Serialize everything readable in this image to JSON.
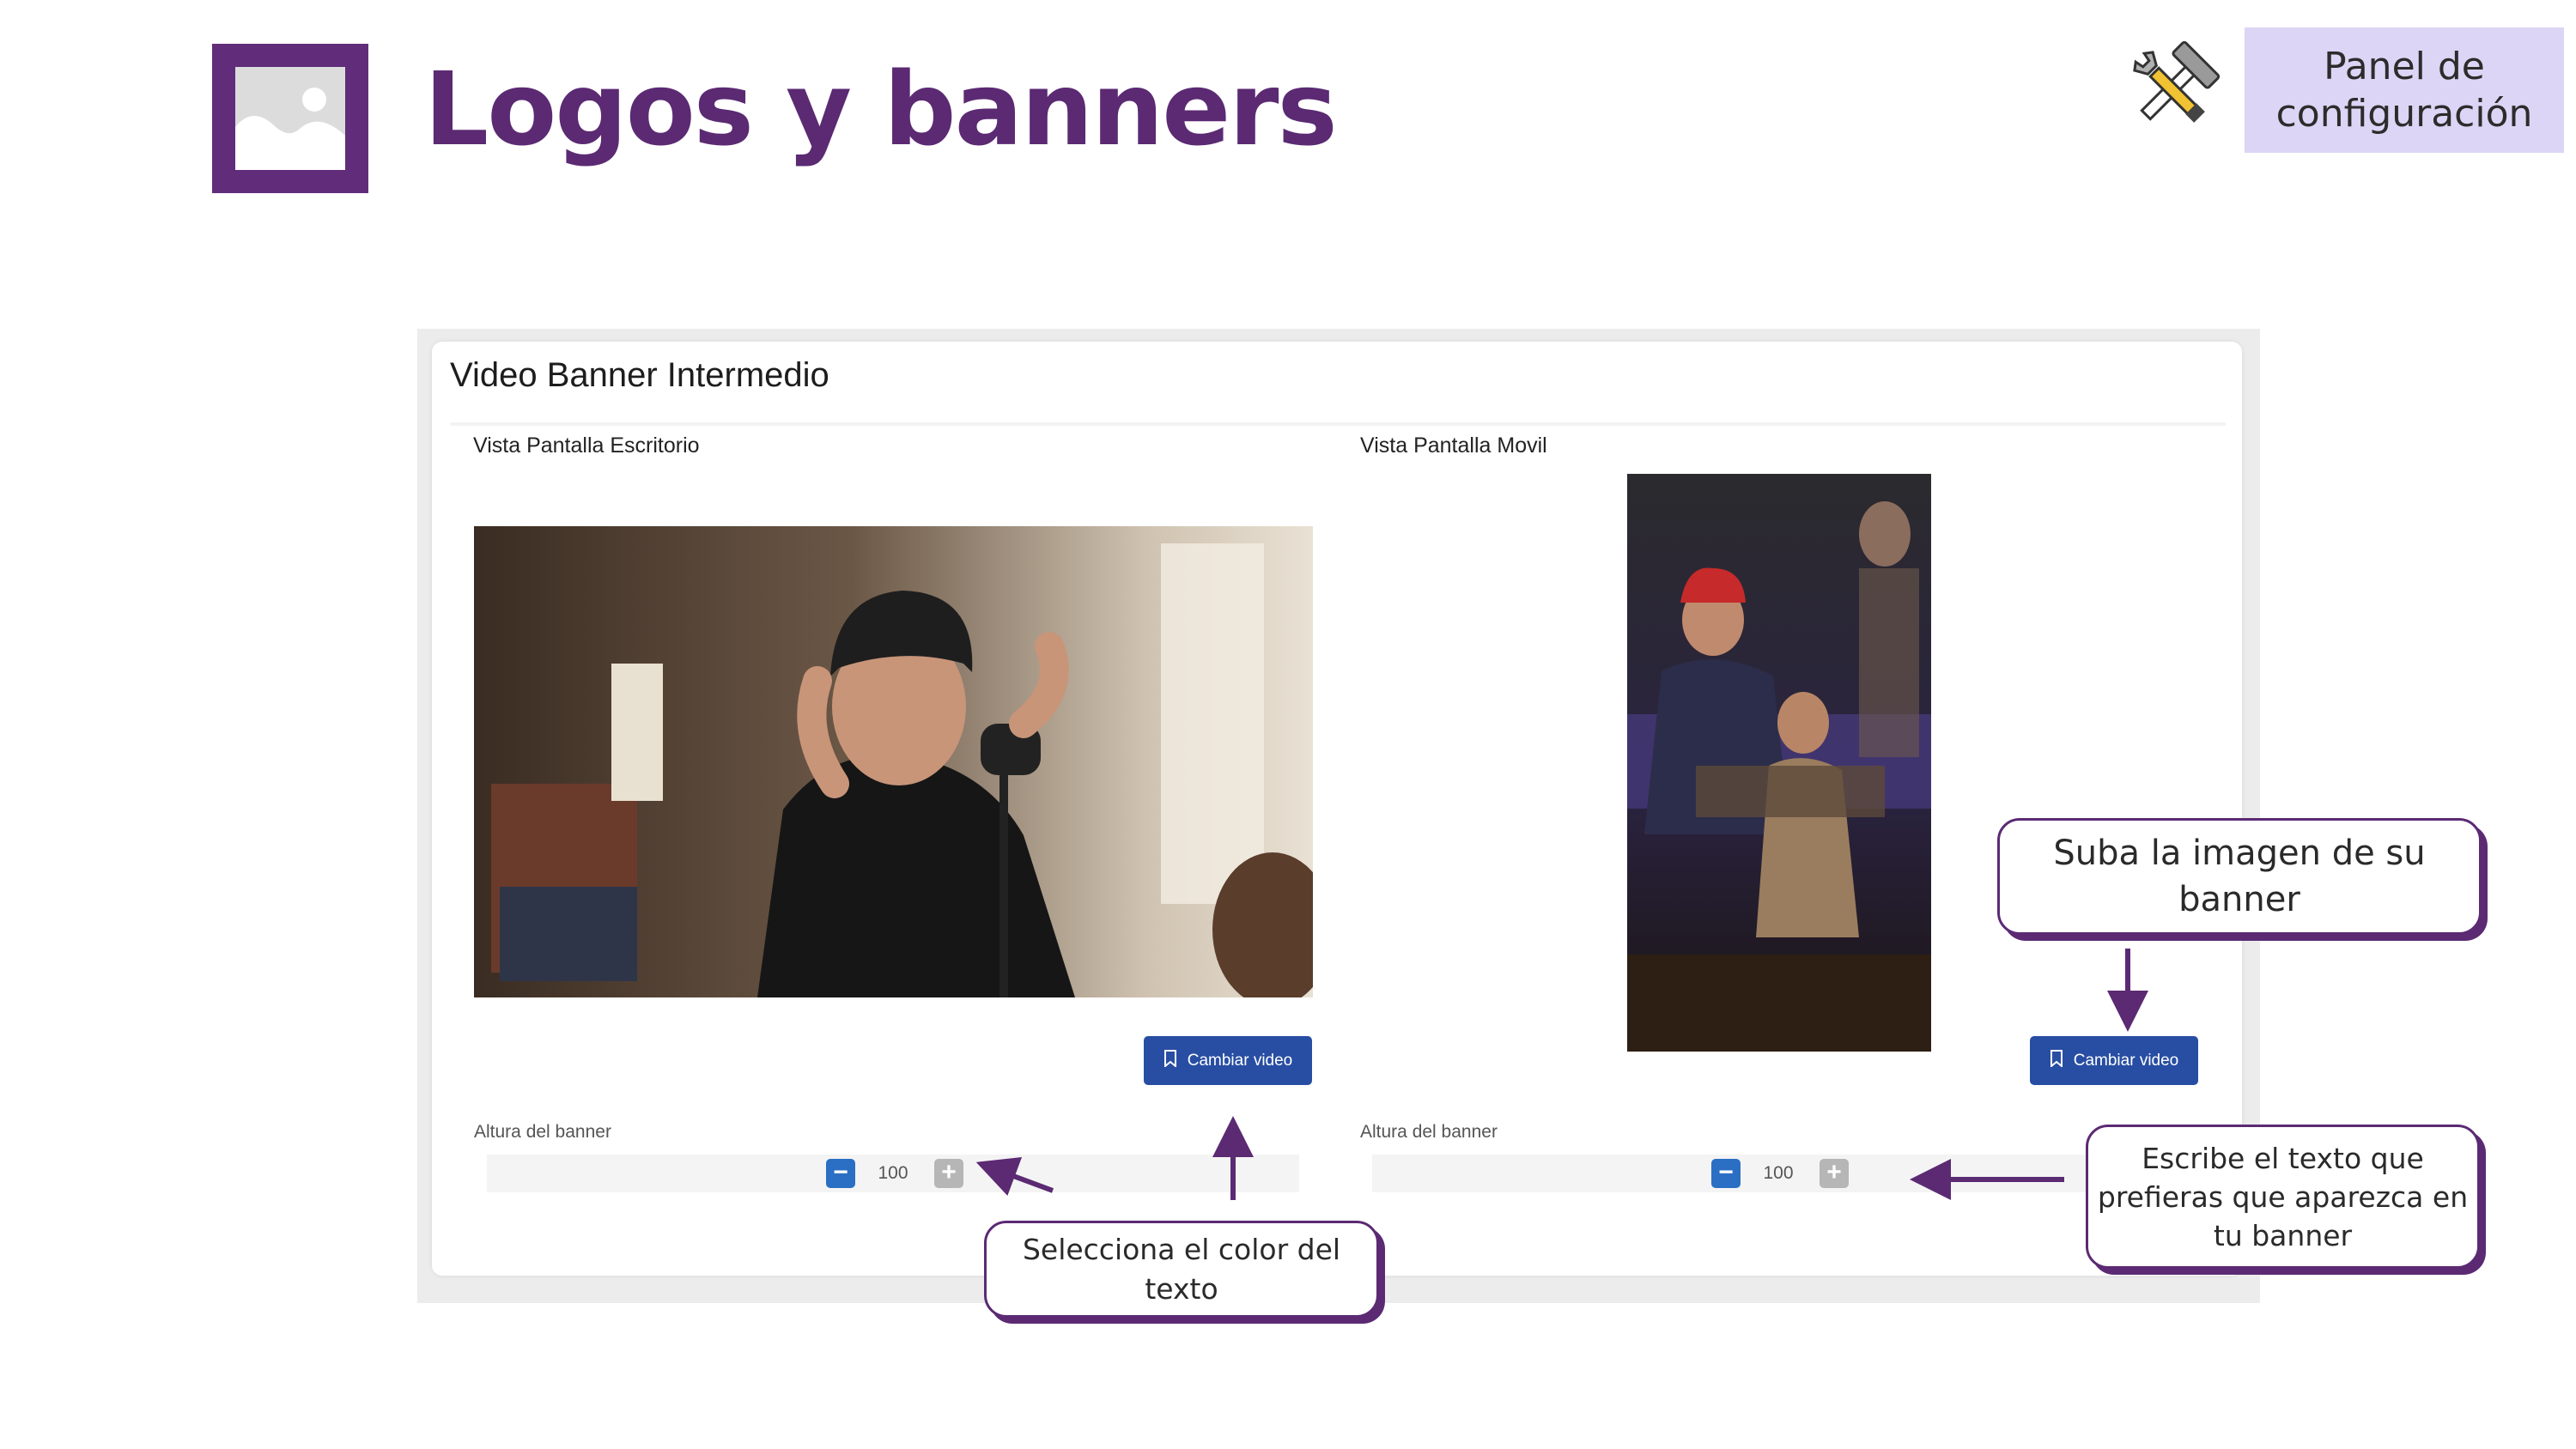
{
  "header": {
    "title": "Logos y banners",
    "icon": "image-placeholder-icon",
    "tools_icon": "hammer-wrench-icon",
    "config_button_line1": "Panel de",
    "config_button_line2": "configuración"
  },
  "card": {
    "title": "Video Banner Intermedio",
    "desktop": {
      "label": "Vista Pantalla Escritorio",
      "change_button": "Cambiar video",
      "height_label": "Altura del banner",
      "height_value": "100"
    },
    "mobile": {
      "label": "Vista Pantalla Movil",
      "change_button": "Cambiar video",
      "height_label": "Altura del banner",
      "height_value": "100"
    }
  },
  "callouts": {
    "upload": "Suba la imagen de su banner",
    "color": "Selecciona el color del texto",
    "text": "Escribe el texto que prefieras que aparezca en tu banner"
  },
  "colors": {
    "brand_purple": "#5b2a73",
    "config_bg": "#dcd5f5",
    "button_blue": "#284ea3",
    "stepper_minus": "#2a6fc4",
    "stepper_plus": "#b6b6b6"
  }
}
